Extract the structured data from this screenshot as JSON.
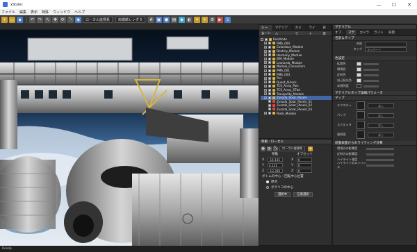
{
  "window": {
    "title": "xStyler",
    "minimize": "—",
    "maximize": "☐",
    "close": "✕"
  },
  "menu": {
    "items": [
      "ファイル",
      "編集",
      "表示",
      "特殊",
      "ウィンドウ",
      "ヘルプ"
    ]
  },
  "toolbar": {
    "coord_select": "ローカル座標系",
    "view_select": "両端統レンダラ"
  },
  "scene": {
    "tabs": [
      "シーン",
      "マテリアル",
      "カメラ",
      "ライト",
      "背景"
    ],
    "header": "シーン",
    "tree": [
      {
        "label": "Roothode",
        "sel": false,
        "red": false
      },
      {
        "label": "PMA_004",
        "sel": false,
        "red": false
      },
      {
        "label": "Columbus_Module",
        "sel": false,
        "red": false
      },
      {
        "label": "Destiny_Module",
        "sel": false,
        "red": false
      },
      {
        "label": "Harmony_Module",
        "sel": false,
        "red": false
      },
      {
        "label": "JEM_Module",
        "sel": false,
        "red": false
      },
      {
        "label": "Leonardo_Module",
        "sel": false,
        "red": false
      },
      {
        "label": "Module_Connectors",
        "sel": false,
        "red": false
      },
      {
        "label": "PMA_001",
        "sel": false,
        "red": false
      },
      {
        "label": "PMA_003",
        "sel": false,
        "red": false
      },
      {
        "label": "Pirs",
        "sel": false,
        "red": false
      },
      {
        "label": "Quest_Airlock",
        "sel": false,
        "red": false
      },
      {
        "label": "TCS_Array_Port",
        "sel": false,
        "red": false
      },
      {
        "label": "TCS_Array_STbd",
        "sel": false,
        "red": false
      },
      {
        "label": "Tranquility_Module",
        "sel": false,
        "red": false
      },
      {
        "label": "Zvezda_Solar_Panels",
        "sel": true,
        "red": false
      },
      {
        "label": "Zvezda_Solar_Panels_01",
        "sel": false,
        "red": true
      },
      {
        "label": "Zvezda_Solar_Panels_02",
        "sel": false,
        "red": true
      },
      {
        "label": "Zvezda_Solar_Panels_03",
        "sel": false,
        "red": true
      },
      {
        "label": "Poisk_Module",
        "sel": false,
        "red": false
      }
    ]
  },
  "transform": {
    "header": "移動 : ローカル",
    "mode_select": "ローカル座標系",
    "col_translate": "移動",
    "col_offset": "オフセット",
    "x_label": "X",
    "y_label": "Y",
    "z_label": "Z",
    "x_value": "-14.101",
    "y_value": "4.121",
    "z_value": "-13.395",
    "ox_value": "0",
    "oy_value": "0",
    "oz_value": "0",
    "pivot_title": "ボトムの中心・回転中心位置",
    "radio_origin": "原点",
    "radio_center": "ボクリコの中心",
    "btn_select": "選択中",
    "btn_apply": "任意選択"
  },
  "material": {
    "title": "マテリアル",
    "tabs": [
      "オブ..",
      "マテ",
      "カメラ",
      "ライト",
      "背景"
    ],
    "sec_name": "名前＆タイプ",
    "name_label": "名前",
    "type_label": "タイプ",
    "type_value": "ランバート",
    "sec_color": "色設定",
    "color_rows": [
      "拡散色",
      "環境色",
      "反射色",
      "自己発光色",
      "半透明度"
    ],
    "sec_params": "マテリアルタイプ詳細パラメータ",
    "sec_map": "マップ",
    "map_rows": [
      "テクスチャ",
      "バンプ",
      "スペキュラ",
      "透明度"
    ],
    "map_none": "なし",
    "sec_lighting": "前面表面からのライティング計算",
    "lighting_rows": [
      "環境光の影響度",
      "反射光の影響度",
      "ハイライト強度",
      "ハイライトのエンハンス"
    ]
  },
  "status": {
    "text": "Ready"
  }
}
